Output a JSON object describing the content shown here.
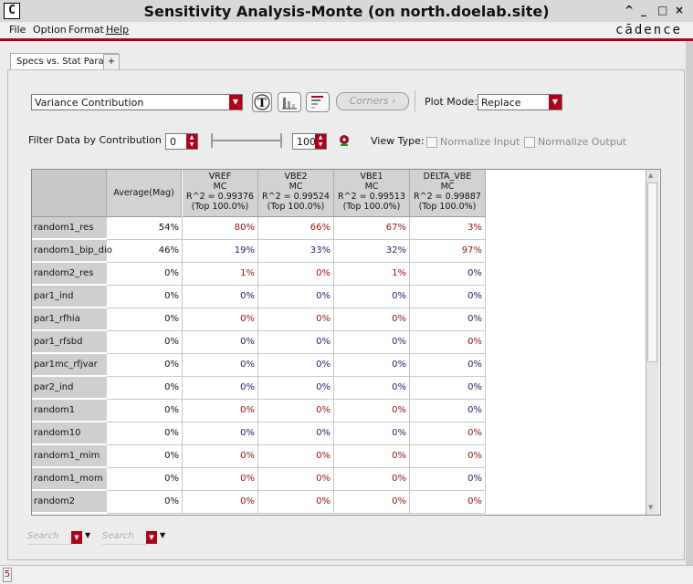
{
  "window": {
    "icon_letter": "C",
    "title": "Sensitivity Analysis-Monte (on north.doelab.site)",
    "controls": [
      "^",
      "_",
      "□",
      "×"
    ]
  },
  "menu": {
    "items": [
      "File",
      "Option",
      "Format",
      "Help"
    ],
    "brand": "cādence"
  },
  "tabs": {
    "active": "Specs vs. Stat Param",
    "add": "+"
  },
  "toolbar": {
    "view_select": "Variance Contribution",
    "corners_label": "Corners",
    "plot_mode_label": "Plot Mode:",
    "plot_mode_value": "Replace"
  },
  "filter": {
    "label": "Filter Data  by Contribution",
    "min_value": "0",
    "max_value": "100",
    "view_type_label": "View Type:",
    "normalize_input": "Normalize Input",
    "normalize_output": "Normalize Output"
  },
  "table": {
    "avg_header": "Average(Mag)",
    "columns": [
      {
        "name": "VREF",
        "type": "MC",
        "r2": "R^2 = 0.99376",
        "top": "(Top 100.0%)"
      },
      {
        "name": "VBE2",
        "type": "MC",
        "r2": "R^2 = 0.99524",
        "top": "(Top 100.0%)"
      },
      {
        "name": "VBE1",
        "type": "MC",
        "r2": "R^2 = 0.99513",
        "top": "(Top 100.0%)"
      },
      {
        "name": "DELTA_VBE",
        "type": "MC",
        "r2": "R^2 = 0.99887",
        "top": "(Top 100.0%)"
      }
    ],
    "rows": [
      {
        "name": "random1_res",
        "avg": "54%",
        "vals": [
          "80%",
          "66%",
          "67%",
          "3%"
        ],
        "colors": [
          "red",
          "red",
          "red",
          "red"
        ]
      },
      {
        "name": "random1_bip_dio",
        "avg": "46%",
        "vals": [
          "19%",
          "33%",
          "32%",
          "97%"
        ],
        "colors": [
          "blue",
          "blue",
          "blue",
          "red"
        ]
      },
      {
        "name": "random2_res",
        "avg": "0%",
        "vals": [
          "1%",
          "0%",
          "1%",
          "0%"
        ],
        "colors": [
          "red",
          "red",
          "red",
          "blue"
        ]
      },
      {
        "name": "par1_ind",
        "avg": "0%",
        "vals": [
          "0%",
          "0%",
          "0%",
          "0%"
        ],
        "colors": [
          "blue",
          "blue",
          "blue",
          "blue"
        ]
      },
      {
        "name": "par1_rfhia",
        "avg": "0%",
        "vals": [
          "0%",
          "0%",
          "0%",
          "0%"
        ],
        "colors": [
          "red",
          "red",
          "red",
          "blue"
        ]
      },
      {
        "name": "par1_rfsbd",
        "avg": "0%",
        "vals": [
          "0%",
          "0%",
          "0%",
          "0%"
        ],
        "colors": [
          "blue",
          "blue",
          "blue",
          "red"
        ]
      },
      {
        "name": "par1mc_rfjvar",
        "avg": "0%",
        "vals": [
          "0%",
          "0%",
          "0%",
          "0%"
        ],
        "colors": [
          "blue",
          "blue",
          "blue",
          "blue"
        ]
      },
      {
        "name": "par2_ind",
        "avg": "0%",
        "vals": [
          "0%",
          "0%",
          "0%",
          "0%"
        ],
        "colors": [
          "blue",
          "blue",
          "blue",
          "blue"
        ]
      },
      {
        "name": "random1",
        "avg": "0%",
        "vals": [
          "0%",
          "0%",
          "0%",
          "0%"
        ],
        "colors": [
          "red",
          "red",
          "red",
          "blue"
        ]
      },
      {
        "name": "random10",
        "avg": "0%",
        "vals": [
          "0%",
          "0%",
          "0%",
          "0%"
        ],
        "colors": [
          "blue",
          "blue",
          "blue",
          "red"
        ]
      },
      {
        "name": "random1_mim",
        "avg": "0%",
        "vals": [
          "0%",
          "0%",
          "0%",
          "0%"
        ],
        "colors": [
          "red",
          "red",
          "red",
          "red"
        ]
      },
      {
        "name": "random1_mom",
        "avg": "0%",
        "vals": [
          "0%",
          "0%",
          "0%",
          "0%"
        ],
        "colors": [
          "red",
          "red",
          "red",
          "blue"
        ]
      },
      {
        "name": "random2",
        "avg": "0%",
        "vals": [
          "0%",
          "0%",
          "0%",
          "0%"
        ],
        "colors": [
          "red",
          "red",
          "red",
          "red"
        ]
      }
    ]
  },
  "search": {
    "placeholder1": "Search",
    "placeholder2": "Search"
  },
  "status": {
    "indicator": "5"
  }
}
